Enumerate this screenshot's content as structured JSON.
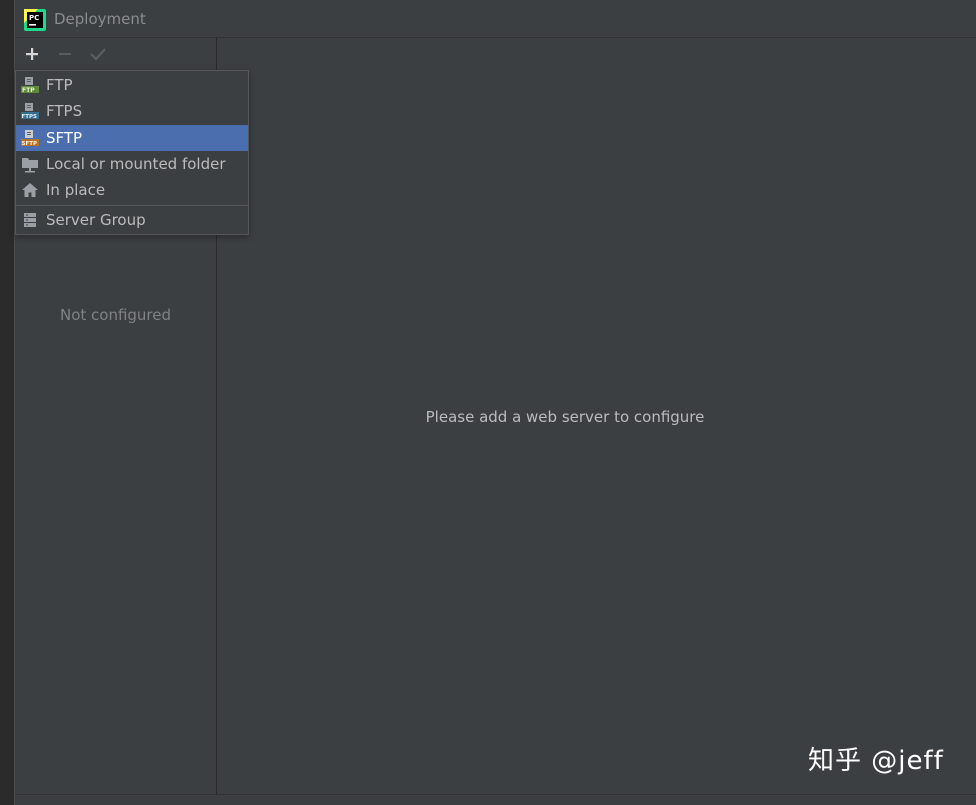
{
  "window": {
    "title": "Deployment",
    "app_icon": "pycharm-logo-icon"
  },
  "toolbar": {
    "add_icon": "plus-icon",
    "remove_icon": "minus-icon",
    "apply_icon": "check-icon"
  },
  "left_panel": {
    "empty_text": "Not configured"
  },
  "right_panel": {
    "hint_text": "Please add a web server to configure"
  },
  "popup": {
    "items": [
      {
        "label": "FTP",
        "icon": "ftp-icon"
      },
      {
        "label": "FTPS",
        "icon": "ftps-icon"
      },
      {
        "label": "SFTP",
        "icon": "sftp-icon",
        "selected": true
      },
      {
        "label": "Local or mounted folder",
        "icon": "folder-icon"
      },
      {
        "label": "In place",
        "icon": "home-icon"
      },
      {
        "label": "Server Group",
        "icon": "server-group-icon"
      }
    ]
  },
  "watermark": "知乎 @jeff",
  "colors": {
    "background": "#3c3f41",
    "selection": "#4b6eaf",
    "text": "#bbbbbb",
    "muted_text": "#7f8285"
  }
}
